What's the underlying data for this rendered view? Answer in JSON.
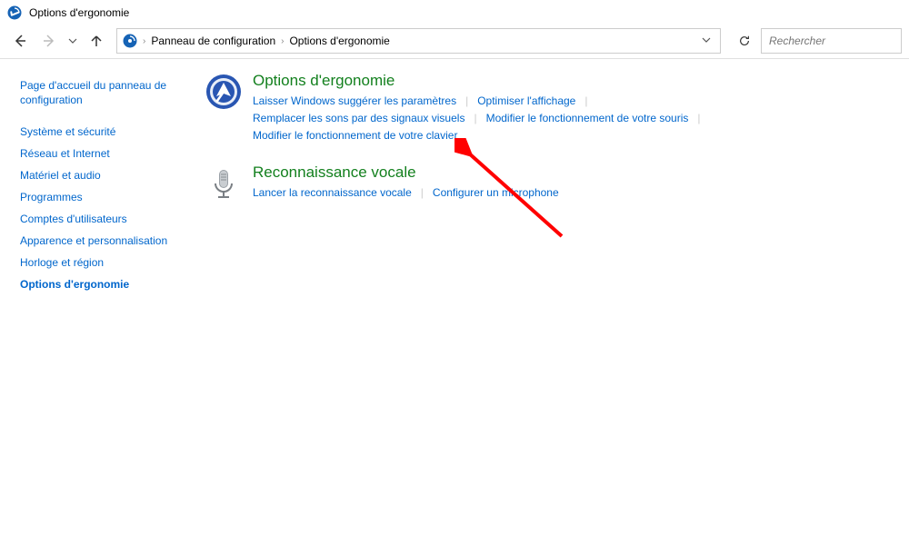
{
  "window": {
    "title": "Options d'ergonomie"
  },
  "breadcrumb": {
    "items": [
      "Panneau de configuration",
      "Options d'ergonomie"
    ]
  },
  "search": {
    "placeholder": "Rechercher"
  },
  "sidebar": {
    "home_label": "Page d'accueil du panneau de configuration",
    "items": [
      "Système et sécurité",
      "Réseau et Internet",
      "Matériel et audio",
      "Programmes",
      "Comptes d'utilisateurs",
      "Apparence et personnalisation",
      "Horloge et région",
      "Options d'ergonomie"
    ],
    "active_index": 7
  },
  "sections": [
    {
      "title": "Options d'ergonomie",
      "icon": "ease-access-icon",
      "links": [
        "Laisser Windows suggérer les paramètres",
        "Optimiser l'affichage",
        "Remplacer les sons par des signaux visuels",
        "Modifier le fonctionnement de votre souris",
        "Modifier le fonctionnement de votre clavier"
      ]
    },
    {
      "title": "Reconnaissance vocale",
      "icon": "microphone-icon",
      "links": [
        "Lancer la reconnaissance vocale",
        "Configurer un microphone"
      ]
    }
  ]
}
